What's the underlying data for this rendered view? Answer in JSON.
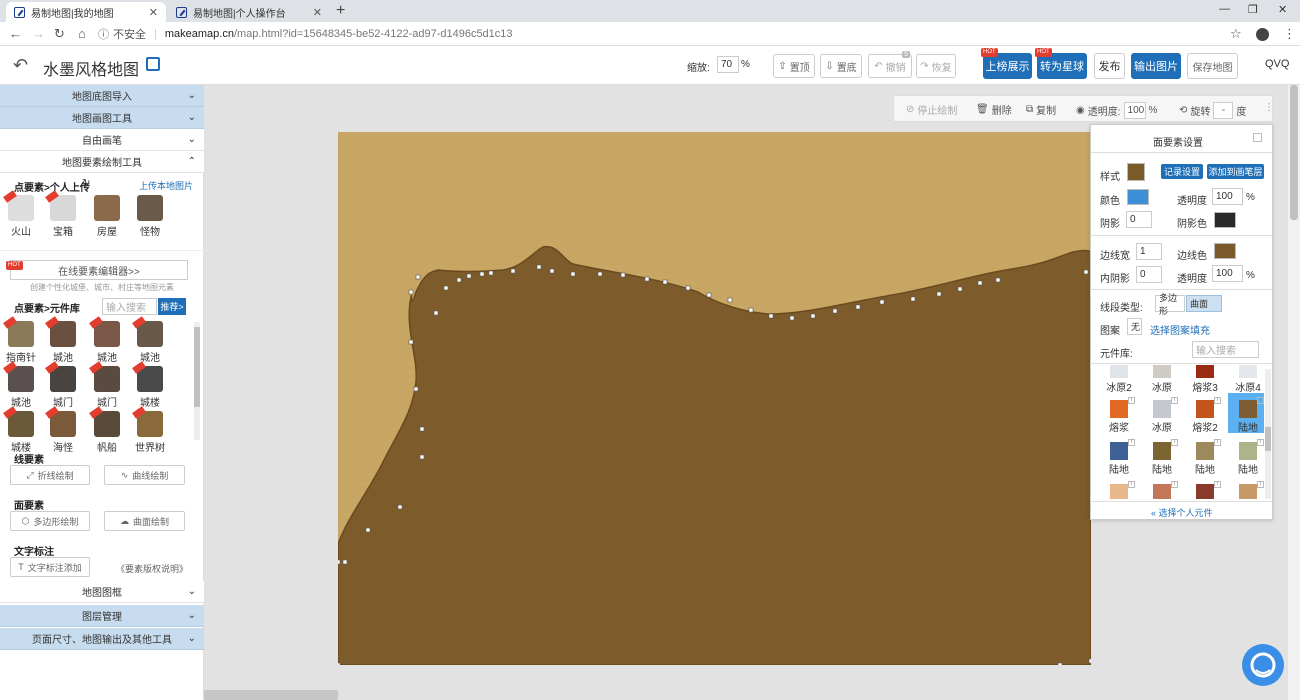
{
  "browser": {
    "tabs": [
      {
        "title": "易制地图|我的地图"
      },
      {
        "title": "易制地图|个人操作台"
      }
    ],
    "insecure_label": "不安全",
    "url_host": "makeamap.cn",
    "url_path": "/map.html?id=15648345-be52-4122-ad97-d1496c5d1c13"
  },
  "header": {
    "title": "水墨风格地图",
    "zoom_label": "缩放:",
    "zoom_value": "70",
    "zoom_unit": "%",
    "top_label": "置顶",
    "bottom_label": "置底",
    "undo_label": "撤销",
    "undo_count": "5",
    "redo_label": "恢复",
    "showcase_label": "上榜展示",
    "globe_label": "转为星球",
    "hot": "HOT",
    "publish_label": "发布",
    "export_label": "输出图片",
    "save_label": "保存地图",
    "user": "QVQ"
  },
  "sidebar": {
    "sections": {
      "basemap_import": "地图底图导入",
      "drawing_tools": "地图画图工具",
      "freehand": "自由画笔",
      "element_tools": "地图要素绘制工具",
      "frame": "地图图框",
      "layers": "图层管理",
      "page_size": "页面尺寸、地图输出及其他工具"
    },
    "point_upload_title": "点要素>个人上传",
    "upload_local": "上传本地图片",
    "personal_items": [
      {
        "label": "火山"
      },
      {
        "label": "宝箱"
      },
      {
        "label": "房屋"
      },
      {
        "label": "怪物"
      }
    ],
    "online_editor": "在线要素编辑器>>",
    "online_editor_desc": "创建个性化城堡、城市、村庄等地图元素",
    "library_title": "点要素>元件库",
    "library_search_placeholder": "输入搜索",
    "recommend": "推荐>",
    "library_items": [
      {
        "label": "指南针"
      },
      {
        "label": "城池"
      },
      {
        "label": "城池"
      },
      {
        "label": "城池"
      },
      {
        "label": "城池"
      },
      {
        "label": "城门"
      },
      {
        "label": "城门"
      },
      {
        "label": "城楼"
      },
      {
        "label": "城楼"
      },
      {
        "label": "海怪"
      },
      {
        "label": "帆船"
      },
      {
        "label": "世界树"
      }
    ],
    "line_title": "线要素",
    "polyline": "折线绘制",
    "curve": "曲线绘制",
    "area_title": "面要素",
    "polygon": "多边形绘制",
    "curved_area": "曲面绘制",
    "text_title": "文字标注",
    "text_add": "文字标注添加",
    "copyright": "《要素版权说明》"
  },
  "edit_toolbar": {
    "stop": "停止绘制",
    "delete": "删除",
    "copy": "复制",
    "opacity_label": "透明度:",
    "opacity_value": "100",
    "opacity_unit": "%",
    "rotate_label": "旋转",
    "rotate_value": "-",
    "rotate_unit": "度"
  },
  "panel": {
    "title": "面要素设置",
    "style_label": "样式",
    "record_btn": "记录设置",
    "add_btn": "添加到画笔层",
    "color_label": "颜色",
    "opacity_label": "透明度",
    "opacity_value": "100",
    "pct": "%",
    "shadow_label": "阴影",
    "shadow_value": "0",
    "shadow_color_label": "阴影色",
    "border_width_label": "边线宽",
    "border_width_value": "1",
    "border_color_label": "边线色",
    "inner_shadow_label": "内阴影",
    "inner_shadow_value": "0",
    "opacity2_label": "透明度",
    "opacity2_value": "100",
    "line_type_label": "线段类型:",
    "line_type_polygon": "多边形",
    "line_type_curve": "曲面",
    "pattern_label": "图案",
    "pattern_none": "无",
    "pattern_choose": "选择图案填充",
    "library_label": "元件库:",
    "library_placeholder": "输入搜索",
    "swatches": [
      {
        "label": "冰原2",
        "color": "#dfe4ea"
      },
      {
        "label": "冰原",
        "color": "#cfcac4"
      },
      {
        "label": "熔浆3",
        "color": "#9a2a12"
      },
      {
        "label": "冰原4",
        "color": "#e4e7ec"
      },
      {
        "label": "熔浆",
        "color": "#e06a24"
      },
      {
        "label": "冰原",
        "color": "#c3c8d0"
      },
      {
        "label": "熔浆2",
        "color": "#c4551a"
      },
      {
        "label": "陆地",
        "color": "#7e5d35"
      },
      {
        "label": "陆地",
        "color": "#3e6296"
      },
      {
        "label": "陆地",
        "color": "#7c6433"
      },
      {
        "label": "陆地",
        "color": "#9c8a5c"
      },
      {
        "label": "陆地",
        "color": "#aeb48a"
      },
      {
        "label": "",
        "color": "#e8b88a"
      },
      {
        "label": "",
        "color": "#c4765a"
      },
      {
        "label": "",
        "color": "#8a3a2a"
      },
      {
        "label": "",
        "color": "#c89a6a"
      }
    ],
    "personal_link": "« 选择个人元件"
  },
  "colors": {
    "style_swatch": "#7a5a2a",
    "color_swatch": "#3d8fd8",
    "shadow_color": "#2a2a2a",
    "border_color": "#7a5a2a",
    "land": "#7d5b2a",
    "parchment": "#c8a664"
  }
}
